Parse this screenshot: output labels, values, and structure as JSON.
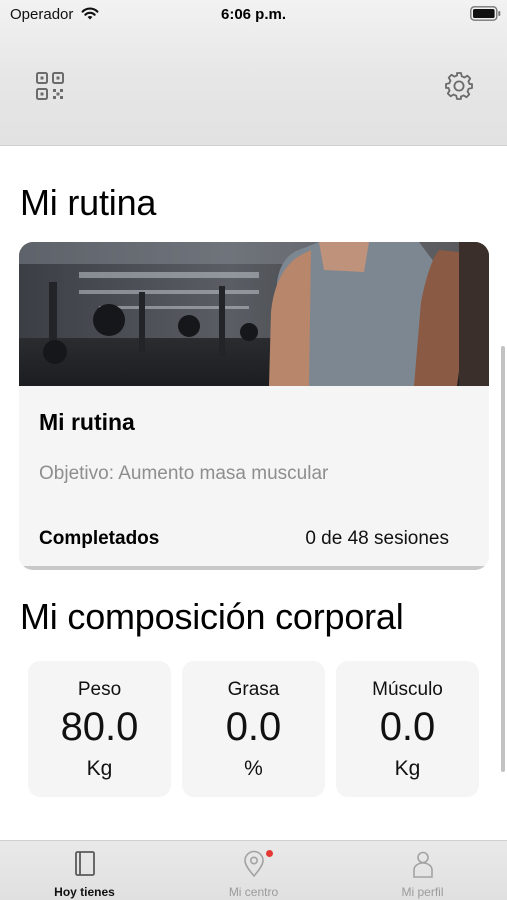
{
  "status_bar": {
    "carrier": "Operador",
    "time": "6:06 p.m."
  },
  "header": {
    "left_icon": "qr-code-icon",
    "right_icon": "gear-icon"
  },
  "routine_section": {
    "title": "Mi rutina",
    "card": {
      "title": "Mi rutina",
      "goal": "Objetivo: Aumento masa muscular",
      "completed_label": "Completados",
      "completed_value": "0 de 48 sesiones"
    }
  },
  "composition_section": {
    "title": "Mi composición corporal",
    "metrics": [
      {
        "label": "Peso",
        "value": "80.0",
        "unit": "Kg"
      },
      {
        "label": "Grasa",
        "value": "0.0",
        "unit": "%"
      },
      {
        "label": "Músculo",
        "value": "0.0",
        "unit": "Kg"
      }
    ]
  },
  "tab_bar": {
    "tabs": [
      {
        "label": "Hoy tienes",
        "icon": "notebook-icon",
        "active": true
      },
      {
        "label": "Mi centro",
        "icon": "location-pin-icon",
        "active": false,
        "badge": true
      },
      {
        "label": "Mi perfil",
        "icon": "person-icon",
        "active": false
      }
    ],
    "accent": "#111111",
    "inactive": "#9b9b9b",
    "badge_color": "#e53935"
  }
}
